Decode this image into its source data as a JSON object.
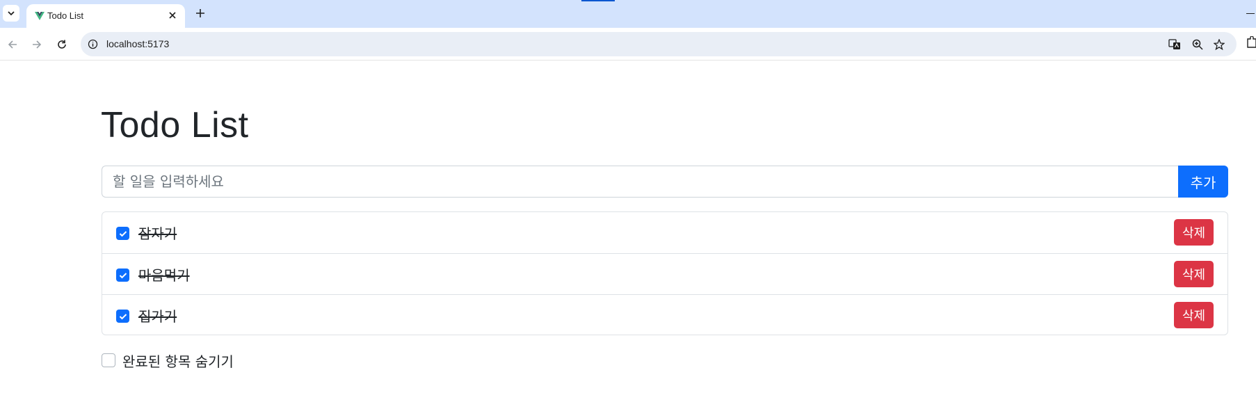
{
  "browser": {
    "tab": {
      "title": "Todo List",
      "favicon": "vue-logo-icon"
    },
    "url": "localhost:5173",
    "icons": [
      "tab-list-icon",
      "close-icon",
      "plus-icon",
      "back-icon",
      "forward-icon",
      "reload-icon",
      "info-icon",
      "translate-icon",
      "zoom-icon",
      "star-icon",
      "extensions-icon"
    ]
  },
  "app": {
    "title": "Todo List",
    "input": {
      "placeholder": "할 일을 입력하세요",
      "value": ""
    },
    "add_label": "추가",
    "todos": [
      {
        "text": "잠자기",
        "done": true,
        "delete_label": "삭제"
      },
      {
        "text": "마음먹기",
        "done": true,
        "delete_label": "삭제"
      },
      {
        "text": "집가기",
        "done": true,
        "delete_label": "삭제"
      }
    ],
    "hide_completed": {
      "label": "완료된 항목 숨기기",
      "checked": false
    }
  },
  "colors": {
    "primary": "#0d6efd",
    "danger": "#dc3545",
    "tabbar": "#d3e3fd",
    "omnibox": "#e9eef6"
  }
}
